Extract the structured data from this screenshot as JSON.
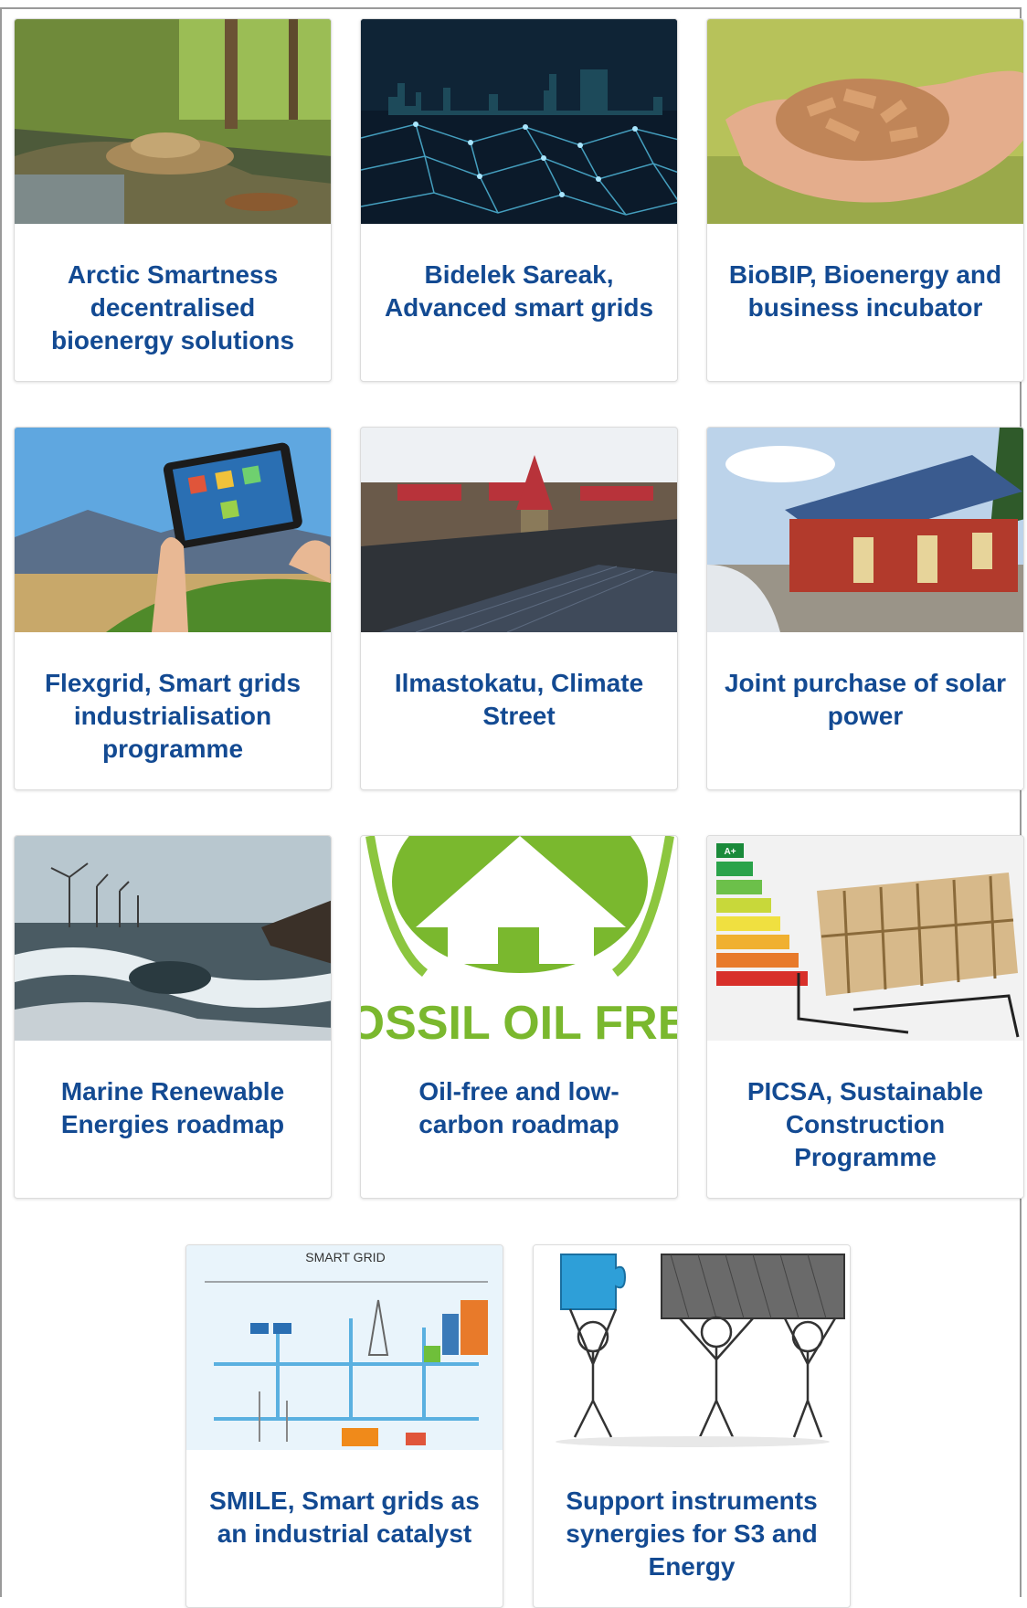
{
  "projects": [
    {
      "title": "Arctic Smartness decentralised bioenergy solutions",
      "image_icon": "wood-pellets-forest-image"
    },
    {
      "title": "Bidelek Sareak, Advanced smart grids",
      "image_icon": "city-network-grid-image"
    },
    {
      "title": "BioBIP, Bioenergy and business incubator",
      "image_icon": "wood-chips-hands-image"
    },
    {
      "title": "Flexgrid, Smart grids industrialisation programme",
      "image_icon": "tablet-landscape-image"
    },
    {
      "title": "Ilmastokatu, Climate Street",
      "image_icon": "solar-rooftop-street-image"
    },
    {
      "title": "Joint purchase of solar power",
      "image_icon": "red-barn-solar-image"
    },
    {
      "title": "Marine Renewable Energies roadmap",
      "image_icon": "offshore-wind-waves-image"
    },
    {
      "title": "Oil-free and low-carbon roadmap",
      "image_icon": "fossil-oil-free-logo-image",
      "image_text": "FOSSIL OIL FREE"
    },
    {
      "title": "PICSA, Sustainable Construction Programme",
      "image_icon": "energy-rating-building-image",
      "image_text": "A+"
    },
    {
      "title": "SMILE, Smart grids as an industrial catalyst",
      "image_icon": "smart-grid-diagram-image",
      "image_text": "SMART GRID"
    },
    {
      "title": "Support instruments synergies for S3 and Energy",
      "image_icon": "puzzle-figures-image"
    }
  ],
  "colors": {
    "title": "#134a92",
    "card_border": "#dcdcdc"
  }
}
